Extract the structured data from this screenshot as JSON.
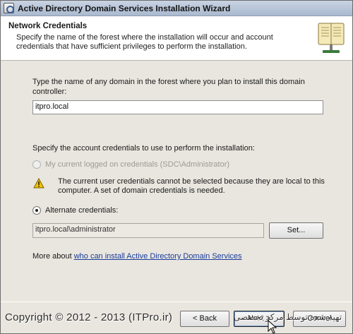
{
  "window": {
    "title": "Active Directory Domain Services Installation Wizard"
  },
  "header": {
    "title": "Network Credentials",
    "description": "Specify the name of the forest where the installation will occur and account credentials that have sufficient privileges to perform the installation."
  },
  "domain_section": {
    "prompt": "Type the name of any domain in the forest where you plan to install this domain controller:",
    "domain_value": "itpro.local"
  },
  "credentials_section": {
    "prompt": "Specify the account credentials to use to perform the installation:",
    "current_user_label": "My current logged on credentials (SDC\\Administrator)",
    "current_user_selected": false,
    "current_user_enabled": false,
    "warning_text": "The current user credentials cannot be selected because they are local to this computer. A set of domain credentials is needed.",
    "alternate_label": "Alternate credentials:",
    "alternate_selected": true,
    "alternate_value": "itpro.local\\administrator",
    "set_button": "Set..."
  },
  "more_about": {
    "prefix": "More about ",
    "link_text": "who can install Active Directory Domain Services"
  },
  "footer": {
    "back_button": "< Back",
    "next_button": "Next >",
    "cancel_button": "Cancel",
    "watermark": "Copyright © 2012 - 2013 (ITPro.ir)",
    "watermark_rtl": "تهیه شده توسط مرکز تخصصی"
  },
  "colors": {
    "link": "#1a3c9a",
    "warning": "#f2c200"
  }
}
